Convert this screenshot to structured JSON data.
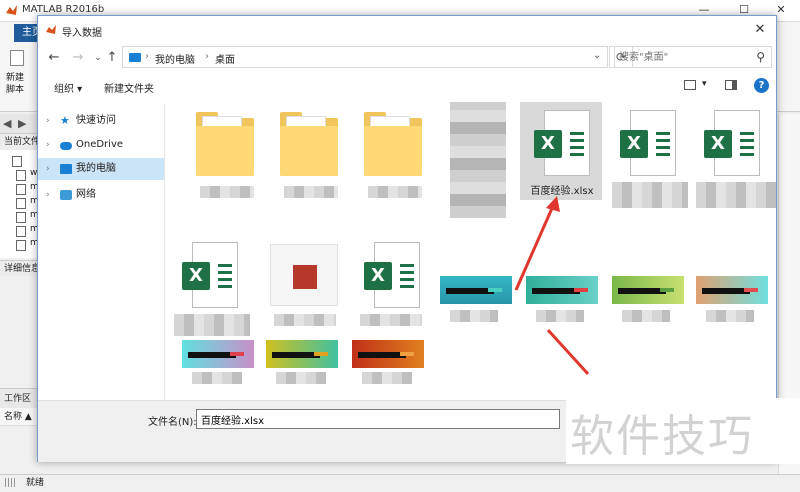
{
  "matlab": {
    "title": "MATLAB R2016b",
    "tab_home": "主页",
    "new_label": "新建\n脚本",
    "current_folder": "当前文件",
    "detail": "详细信息",
    "workspace": "工作区",
    "name_col": "名称 ▲",
    "status": "就绪",
    "file_prefixes": [
      "w",
      "m",
      "m",
      "m",
      "m",
      "m"
    ]
  },
  "dialog": {
    "title": "导入数据",
    "close": "✕",
    "breadcrumb": [
      "我的电脑",
      "桌面"
    ],
    "breadcrumb_sep": "›",
    "search_placeholder": "搜索\"桌面\"",
    "toolbar": {
      "organize": "组织 ▾",
      "new_folder": "新建文件夹"
    },
    "help": "?",
    "sidebar": [
      {
        "label": "快速访问",
        "icon": "star-icon"
      },
      {
        "label": "OneDrive",
        "icon": "cloud-icon"
      },
      {
        "label": "我的电脑",
        "icon": "computer-icon",
        "selected": true
      },
      {
        "label": "网络",
        "icon": "network-icon"
      }
    ],
    "selected_file": "百度经验.xlsx",
    "filename_label": "文件名(N):",
    "filename_value": "百度经验.xlsx"
  },
  "watermark": "软件技巧",
  "colors": {
    "excel_green": "#1e7145",
    "folder": "#f2c55c",
    "arrow": "#e0362d",
    "accent": "#1a80d4"
  }
}
